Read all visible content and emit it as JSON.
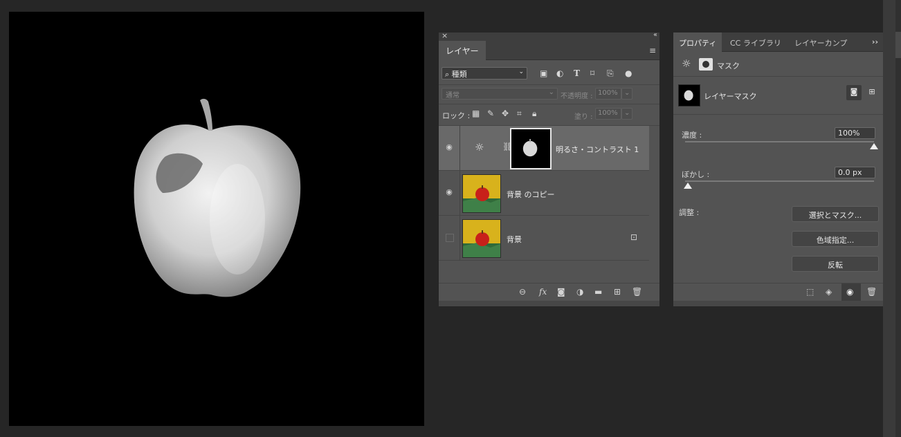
{
  "layers_panel": {
    "close_glyph": "×",
    "collapse_glyph": "‹‹",
    "tab": "レイヤー",
    "menu_glyph": "≡",
    "filter": {
      "kind_label": "種類",
      "icons": [
        "image-filter-icon",
        "adjustment-filter-icon",
        "type-filter-icon",
        "shape-filter-icon",
        "smart-object-filter-icon",
        "filter-toggle-icon"
      ]
    },
    "blend_mode": "通常",
    "opacity_label": "不透明度 :",
    "opacity_value": "100%",
    "lock_label": "ロック :",
    "fill_label": "塗り :",
    "fill_value": "100%",
    "layers": [
      {
        "name": "明るさ・コントラスト 1",
        "type": "adjustment",
        "visible": true,
        "selected": true
      },
      {
        "name": "背景 のコピー",
        "type": "image",
        "visible": true,
        "selected": false
      },
      {
        "name": "背景",
        "type": "image",
        "visible": false,
        "selected": false,
        "locked": true
      }
    ]
  },
  "properties_panel": {
    "tabs": [
      "プロパティ",
      "CC ライブラリ",
      "レイヤーカンプ"
    ],
    "more_glyph": "››",
    "menu_glyph": "≡",
    "header_label": "マスク",
    "mask_label": "レイヤーマスク",
    "density_label": "濃度 :",
    "density_value": "100%",
    "density_level": 1.0,
    "feather_label": "ぼかし :",
    "feather_value": "0.0 px",
    "feather_level": 0.0,
    "adjust_label": "調整 :",
    "buttons": [
      "選択とマスク...",
      "色域指定...",
      "反転"
    ]
  }
}
